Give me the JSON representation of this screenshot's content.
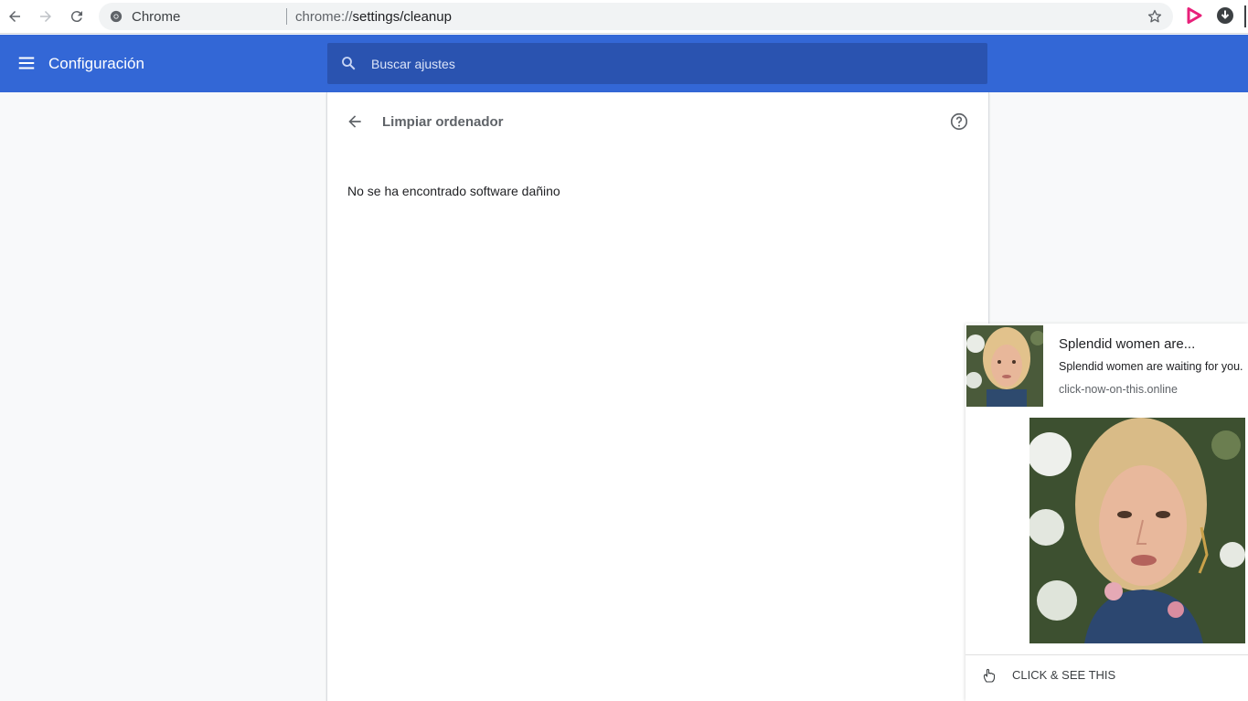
{
  "browser": {
    "site_name": "Chrome",
    "url_scheme": "chrome://",
    "url_path": "settings/cleanup"
  },
  "settings": {
    "header_title": "Configuración",
    "search_placeholder": "Buscar ajustes",
    "accent_color": "#3367d6",
    "page_title": "Limpiar ordenador",
    "status_message": "No se ha encontrado software dañino"
  },
  "notification": {
    "title": "Splendid women are...",
    "body": "Splendid women are waiting for you.",
    "origin": "click-now-on-this.online",
    "action_label": "CLICK & SEE THIS",
    "image_description_icon": "photo-icon"
  }
}
